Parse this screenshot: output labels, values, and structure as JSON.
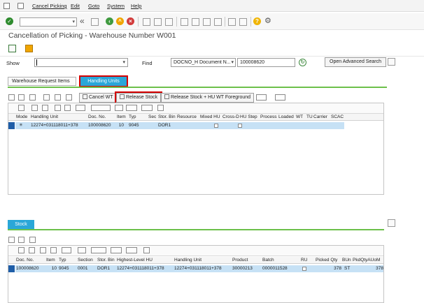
{
  "menu": {
    "items": [
      "Cancel Picking",
      "Edit",
      "Goto",
      "System",
      "Help"
    ]
  },
  "title": "Cancellation of Picking - Warehouse Number W001",
  "form": {
    "show_label": "Show",
    "show_value": "",
    "find_label": "Find",
    "find_field": "DOCNO_H Document N...",
    "find_value": "100008620",
    "advanced_search": "Open Advanced Search"
  },
  "tabs": [
    {
      "label": "Warehouse Request Items",
      "active": false
    },
    {
      "label": "Handling Units",
      "active": true
    }
  ],
  "hu_toolbar": {
    "cancel_wt": "Cancel WT",
    "release_stock": "Release Stock",
    "release_stock_hu": "Release Stock + HU WT Foreground"
  },
  "hu_table": {
    "headers": [
      "Mode",
      "Handling Unit",
      "Doc. No.",
      "Item",
      "Typ",
      "Sec",
      "Stor. Bin",
      "Resource",
      "Mixed HU",
      "Cross-D",
      "HU Step",
      "Process",
      "Loaded",
      "WT",
      "TU",
      "Carrier",
      "SCAC"
    ],
    "rows": [
      {
        "mode": "≡",
        "handling_unit": "12274+031118011+378",
        "doc_no": "100008620",
        "item": "10",
        "typ": "9045",
        "sec": "",
        "stor_bin": "DOR1"
      }
    ]
  },
  "stock_tab": "Stock",
  "stock_table": {
    "headers": [
      "Doc. No.",
      "Item",
      "Typ",
      "Section",
      "Stor. Bin",
      "Highest-Level HU",
      "Handling Unit",
      "Product",
      "Batch",
      "RU",
      "Picked Qty",
      "BUn",
      "PkdQtyAUoM"
    ],
    "rows": [
      {
        "doc_no": "100008620",
        "item": "10",
        "typ": "9045",
        "section": "0001",
        "stor_bin": "DOR1",
        "highest_hu": "12274+031118011+378",
        "handling_unit": "12274+031118011+378",
        "product": "30000213",
        "batch": "0000011528",
        "ru": "",
        "picked_qty": "378",
        "bun": "ST",
        "pkd_qty": "378"
      }
    ]
  },
  "colors": {
    "accent": "#2aa7d8",
    "highlight": "#d40000",
    "selection": "#c6e1f5",
    "green": "#6cc04a"
  }
}
